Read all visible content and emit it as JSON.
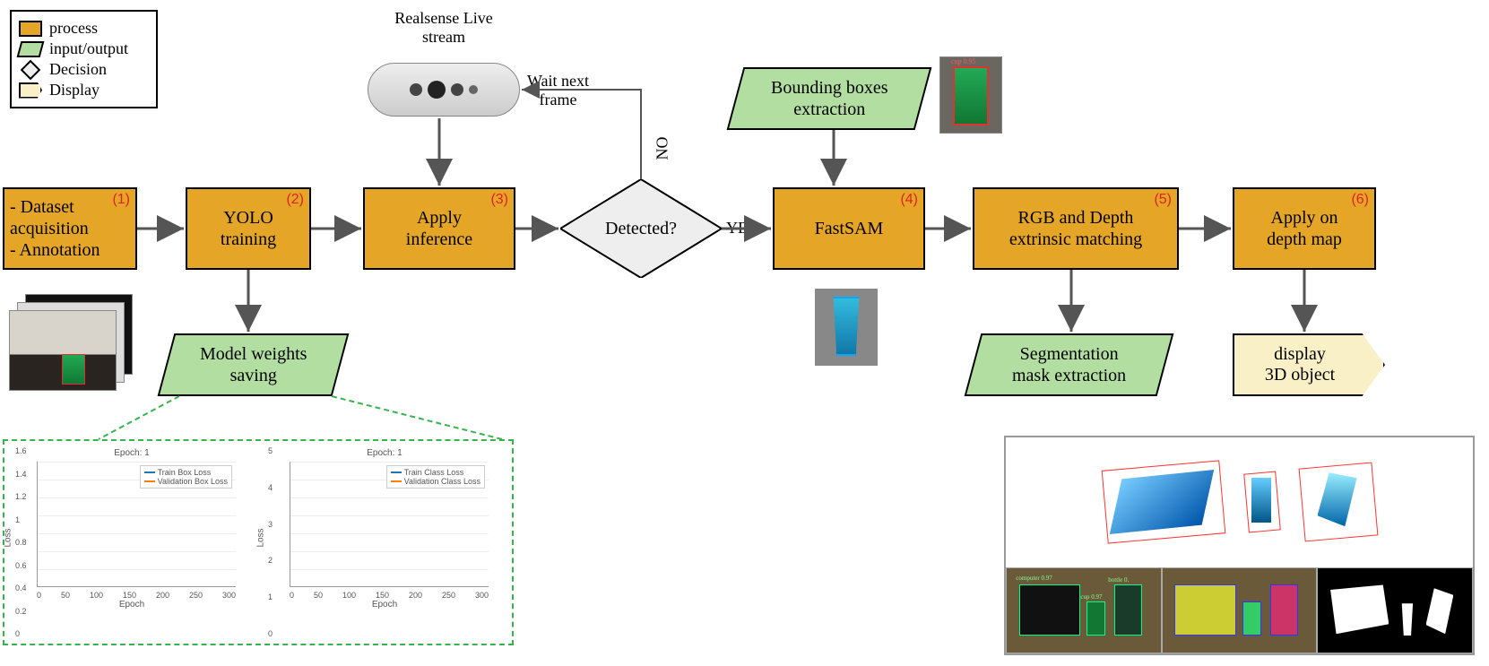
{
  "legend": {
    "process": "process",
    "io": "input/output",
    "decision": "Decision",
    "display": "Display"
  },
  "nodes": {
    "step1": {
      "tag": "(1)",
      "lines": [
        "- Dataset",
        "acquisition",
        "- Annotation"
      ]
    },
    "step2": {
      "tag": "(2)",
      "label": "YOLO\ntraining"
    },
    "step3": {
      "tag": "(3)",
      "label": "Apply\ninference"
    },
    "step4": {
      "tag": "(4)",
      "label": "FastSAM"
    },
    "step5": {
      "tag": "(5)",
      "label": "RGB and Depth\nextrinsic matching"
    },
    "step6": {
      "tag": "(6)",
      "label": "Apply on\ndepth map"
    },
    "decision": "Detected?",
    "io_bbox": "Bounding boxes\nextraction",
    "io_weights": "Model weights\nsaving",
    "io_segmask": "Segmentation\nmask extraction",
    "display_3d": "display\n3D object"
  },
  "labels": {
    "realsense": "Realsense Live\nstream",
    "wait_next": "Wait next\nframe",
    "no": "NO",
    "yes": "YES"
  },
  "chart_data": [
    {
      "type": "line",
      "title": "Epoch: 1",
      "xlabel": "Epoch",
      "ylabel": "Loss",
      "xlim": [
        0,
        300
      ],
      "ylim": [
        0,
        1.6
      ],
      "x_ticks": [
        0,
        50,
        100,
        150,
        200,
        250,
        300
      ],
      "y_ticks": [
        0.0,
        0.2,
        0.4,
        0.6,
        0.8,
        1.0,
        1.2,
        1.4,
        1.6
      ],
      "series": [
        {
          "name": "Train Box Loss",
          "color": "#1f77b4",
          "values": []
        },
        {
          "name": "Validation Box Loss",
          "color": "#ff7f0e",
          "values": []
        }
      ]
    },
    {
      "type": "line",
      "title": "Epoch: 1",
      "xlabel": "Epoch",
      "ylabel": "Loss",
      "xlim": [
        0,
        300
      ],
      "ylim": [
        0,
        5
      ],
      "x_ticks": [
        0,
        50,
        100,
        150,
        200,
        250,
        300
      ],
      "y_ticks": [
        0,
        1,
        2,
        3,
        4,
        5
      ],
      "series": [
        {
          "name": "Train Class Loss",
          "color": "#1f77b4",
          "values": []
        },
        {
          "name": "Validation Class Loss",
          "color": "#ff7f0e",
          "values": []
        }
      ]
    }
  ],
  "sample_images": {
    "dataset_thumb": "annotated cup on desk (stacked frames)",
    "bbox_thumb": "green cup with red bounding box, label 'cup 0.95'",
    "fastsam_thumb": "blue segmented cup on gray",
    "result_top": "3D point-cloud objects with red wireframe bboxes",
    "result_bot_left": "detection overlay: computer 0.97, cup 0.97, bottle 0...",
    "result_bot_mid": "colored segmentation masks over objects",
    "result_bot_right": "binary mask (white shapes on black)",
    "realsense_camera": "Intel RealSense depth camera"
  }
}
